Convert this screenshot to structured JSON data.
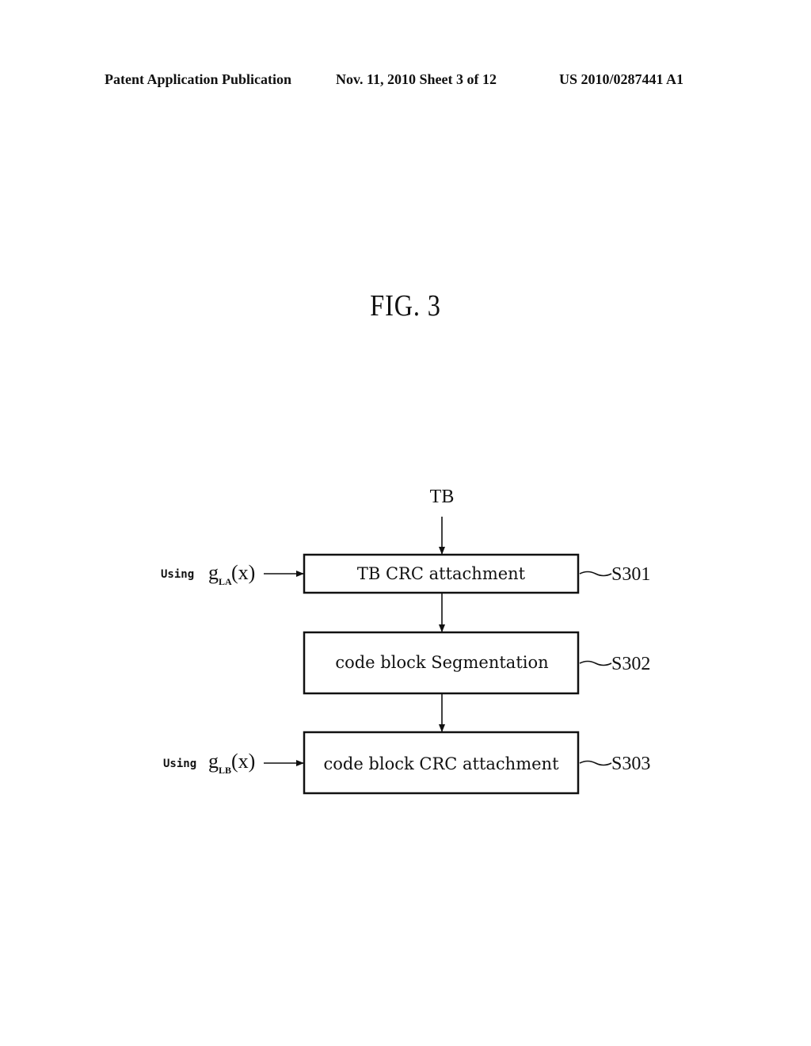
{
  "header": {
    "publication": "Patent Application Publication",
    "date_sheet": "Nov. 11, 2010   Sheet 3 of 12",
    "number": "US 2010/0287441 A1"
  },
  "figure": {
    "title": "FIG. 3",
    "input_label": "TB",
    "steps": [
      {
        "label": "TB CRC attachment",
        "ref": "S301"
      },
      {
        "label": "code block Segmentation",
        "ref": "S302"
      },
      {
        "label": "code block CRC attachment",
        "ref": "S303"
      }
    ],
    "side_inputs": [
      {
        "prefix": "Using",
        "func": "g",
        "subscript": "LA",
        "arg": "(x)"
      },
      {
        "prefix": "Using",
        "func": "g",
        "subscript": "LB",
        "arg": "(x)"
      }
    ]
  }
}
